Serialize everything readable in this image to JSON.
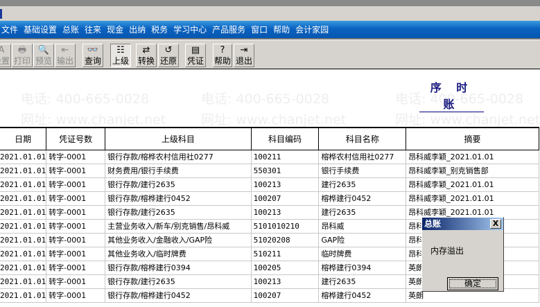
{
  "menu": [
    "文件",
    "基础设置",
    "总账",
    "往来",
    "现金",
    "出纳",
    "税务",
    "学习中心",
    "产品服务",
    "窗口",
    "帮助",
    "会计家园"
  ],
  "toolbar": [
    {
      "label": "设置",
      "icon": "A",
      "disabled": true
    },
    {
      "label": "打印",
      "icon": "🖶",
      "disabled": true
    },
    {
      "label": "预览",
      "icon": "🔍",
      "disabled": true
    },
    {
      "label": "输出",
      "icon": "⇤",
      "disabled": true
    },
    {
      "label": "查询",
      "icon": "👓",
      "disabled": false
    },
    {
      "label": "上级",
      "icon": "☷",
      "disabled": false
    },
    {
      "label": "转换",
      "icon": "⇄",
      "disabled": false
    },
    {
      "label": "还原",
      "icon": "↺",
      "disabled": false
    },
    {
      "label": "凭证",
      "icon": "▤",
      "disabled": false
    },
    {
      "label": "帮助",
      "icon": "?",
      "disabled": false
    },
    {
      "label": "退出",
      "icon": "⇥",
      "disabled": false
    }
  ],
  "report_title": "序 时 账",
  "watermark": {
    "phone": "电话: 400-665-0028",
    "site": "网址: www.chanjet.net"
  },
  "columns": [
    "日期",
    "凭证号数",
    "上级科目",
    "科目编码",
    "科目名称",
    "摘要"
  ],
  "rows": [
    [
      "2021.01.01",
      "转字-0001",
      "银行存款/榕桦农村信用社0277",
      "100211",
      "榕桦农村信用社0277",
      "昂科威李颖_2021.01.01"
    ],
    [
      "2021.01.01",
      "转字-0001",
      "财务费用/银行手续费",
      "550301",
      "银行手续费",
      "昂科威李颖_别克销售部"
    ],
    [
      "2021.01.01",
      "转字-0001",
      "银行存款/建行2635",
      "100213",
      "建行2635",
      "昂科威李颖_2021.01.01"
    ],
    [
      "2021.01.01",
      "转字-0001",
      "银行存款/榕桦建行0452",
      "100207",
      "榕桦建行0452",
      "昂科威李颖_2021.01.01"
    ],
    [
      "2021.01.01",
      "转字-0001",
      "银行存款/建行2635",
      "100213",
      "建行2635",
      "昂科威李颖_2021.01.01"
    ],
    [
      "2021.01.01",
      "转字-0001",
      "主营业务收入/新车/别克销售/昂科威",
      "5101010210",
      "昂科威",
      "昂科"
    ],
    [
      "2021.01.01",
      "转字-0001",
      "其他业务收入/金融收入/GAP险",
      "51020208",
      "GAP险",
      "昂科"
    ],
    [
      "2021.01.01",
      "转字-0001",
      "其他业务收入/临时牌费",
      "510211",
      "临时牌费",
      "昂科"
    ],
    [
      "2021.01.01",
      "转字-0001",
      "银行存款/榕桦建行0394",
      "100205",
      "榕桦建行0394",
      "英朗"
    ],
    [
      "2021.01.01",
      "转字-0001",
      "银行存款/建行2635",
      "100213",
      "建行2635",
      "英朗"
    ],
    [
      "2021.01.01",
      "转字-0001",
      "银行存款/榕桦建行0452",
      "100207",
      "榕桦建行0452",
      "英朗"
    ]
  ],
  "dialog": {
    "title": "总账",
    "message": "内存溢出",
    "ok": "确定",
    "close": "X"
  }
}
